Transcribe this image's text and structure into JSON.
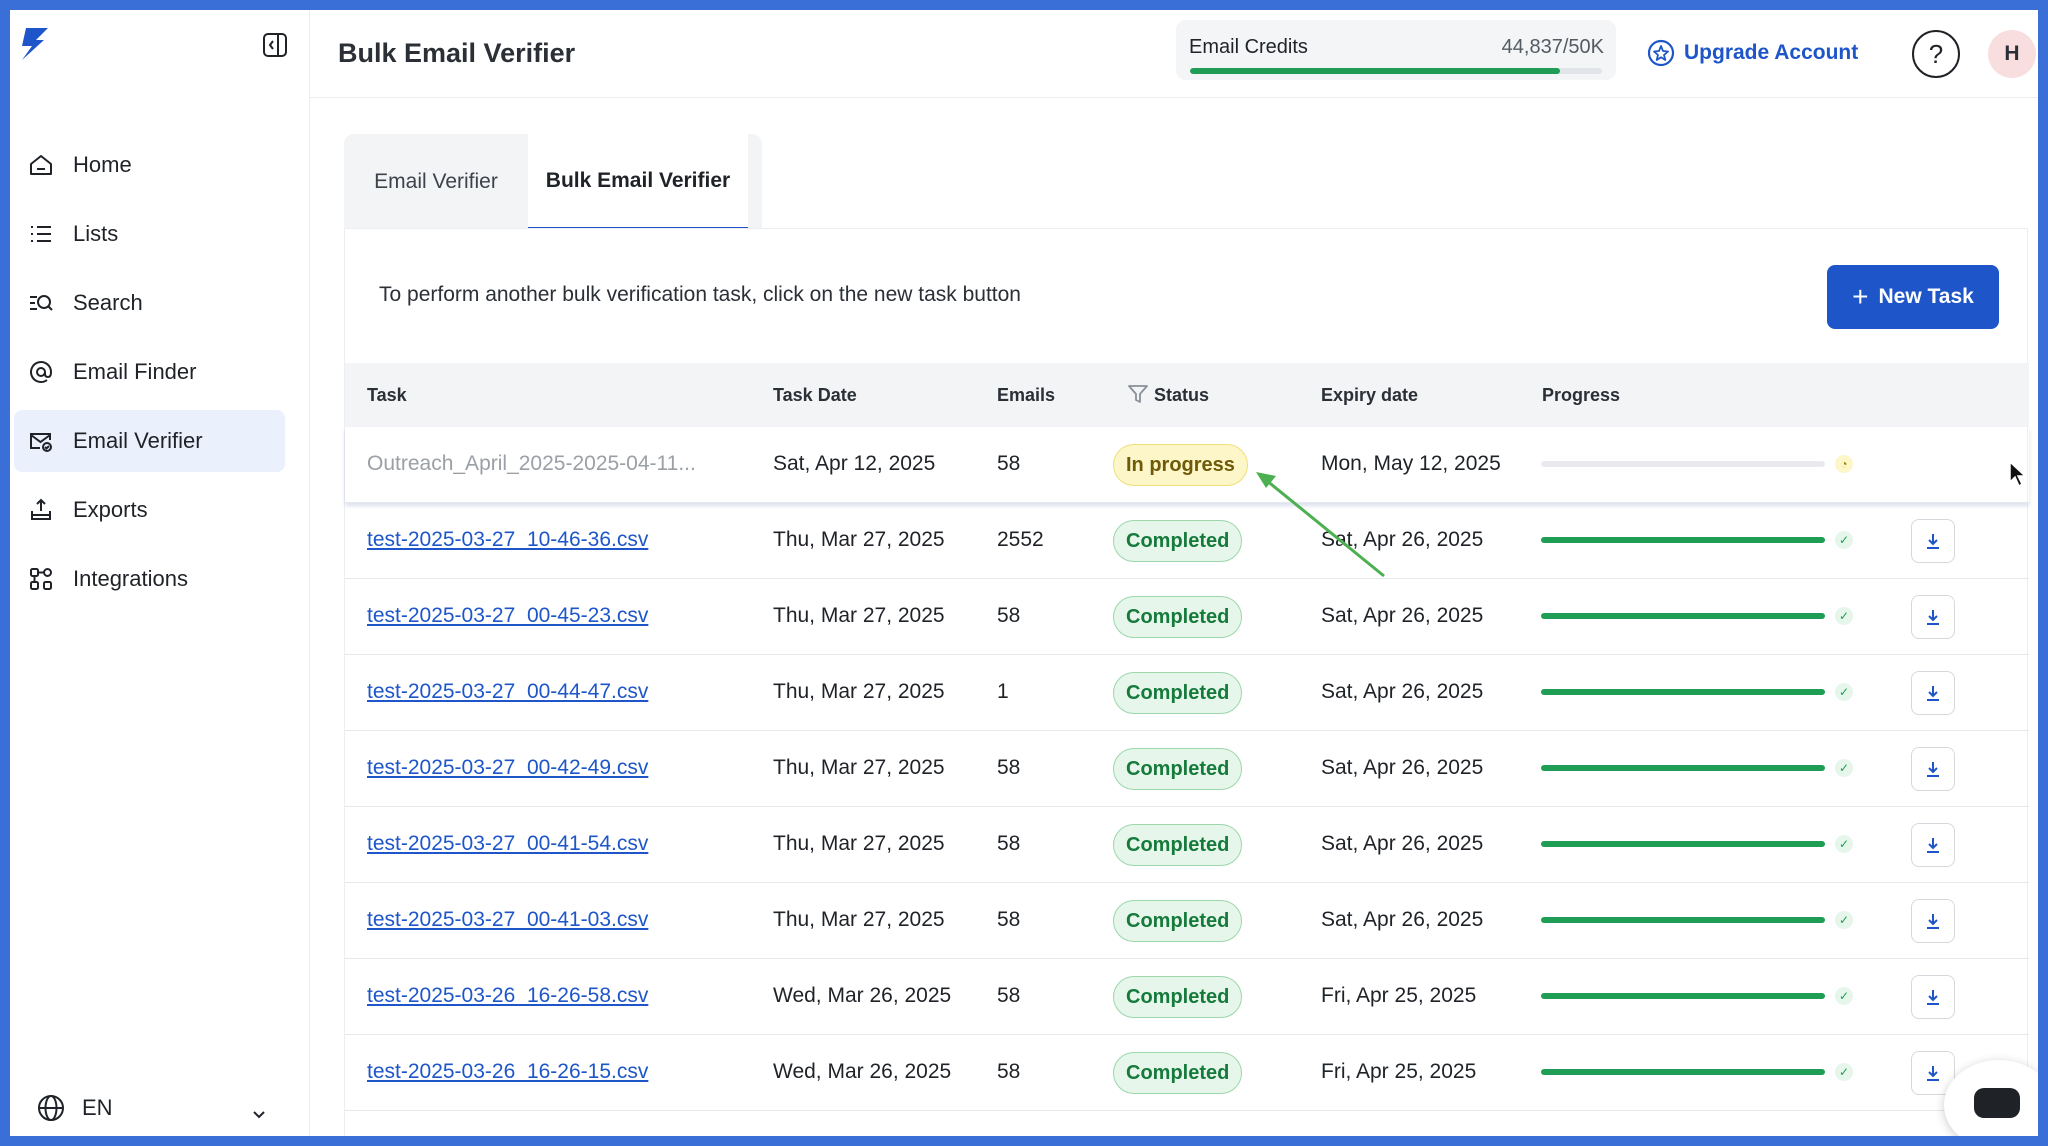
{
  "app": {
    "page_title": "Bulk Email Verifier"
  },
  "header": {
    "credits_label": "Email Credits",
    "credits_value": "44,837/50K",
    "credits_fraction": 0.897,
    "upgrade_label": "Upgrade Account",
    "help_label": "?",
    "avatar_initial": "H"
  },
  "sidebar": {
    "items": [
      {
        "label": "Home",
        "icon": "home-icon"
      },
      {
        "label": "Lists",
        "icon": "list-icon"
      },
      {
        "label": "Search",
        "icon": "search-list-icon"
      },
      {
        "label": "Email Finder",
        "icon": "at-sign-icon"
      },
      {
        "label": "Email Verifier",
        "icon": "mail-check-icon",
        "active": true
      },
      {
        "label": "Exports",
        "icon": "export-icon"
      },
      {
        "label": "Integrations",
        "icon": "integrations-icon"
      }
    ],
    "language": "EN"
  },
  "tabs": [
    {
      "label": "Email Verifier"
    },
    {
      "label": "Bulk Email Verifier",
      "active": true
    }
  ],
  "panel": {
    "hint": "To perform another bulk verification task, click on the new task button",
    "new_task_label": "New Task",
    "new_task_plus": "+"
  },
  "table": {
    "columns": [
      "Task",
      "Task Date",
      "Emails",
      "Status",
      "Expiry date",
      "Progress"
    ],
    "rows": [
      {
        "task": "Outreach_April_2025-2025-04-11...",
        "date": "Sat, Apr 12, 2025",
        "emails": "58",
        "status": "In progress",
        "expiry": "Mon, May 12, 2025",
        "progress": 0.0
      },
      {
        "task": "test-2025-03-27_10-46-36.csv",
        "date": "Thu, Mar 27, 2025",
        "emails": "2552",
        "status": "Completed",
        "expiry": "Sat, Apr 26, 2025",
        "progress": 1.0
      },
      {
        "task": "test-2025-03-27_00-45-23.csv",
        "date": "Thu, Mar 27, 2025",
        "emails": "58",
        "status": "Completed",
        "expiry": "Sat, Apr 26, 2025",
        "progress": 1.0
      },
      {
        "task": "test-2025-03-27_00-44-47.csv",
        "date": "Thu, Mar 27, 2025",
        "emails": "1",
        "status": "Completed",
        "expiry": "Sat, Apr 26, 2025",
        "progress": 1.0
      },
      {
        "task": "test-2025-03-27_00-42-49.csv",
        "date": "Thu, Mar 27, 2025",
        "emails": "58",
        "status": "Completed",
        "expiry": "Sat, Apr 26, 2025",
        "progress": 1.0
      },
      {
        "task": "test-2025-03-27_00-41-54.csv",
        "date": "Thu, Mar 27, 2025",
        "emails": "58",
        "status": "Completed",
        "expiry": "Sat, Apr 26, 2025",
        "progress": 1.0
      },
      {
        "task": "test-2025-03-27_00-41-03.csv",
        "date": "Thu, Mar 27, 2025",
        "emails": "58",
        "status": "Completed",
        "expiry": "Sat, Apr 26, 2025",
        "progress": 1.0
      },
      {
        "task": "test-2025-03-26_16-26-58.csv",
        "date": "Wed, Mar 26, 2025",
        "emails": "58",
        "status": "Completed",
        "expiry": "Fri, Apr 25, 2025",
        "progress": 1.0
      },
      {
        "task": "test-2025-03-26_16-26-15.csv",
        "date": "Wed, Mar 26, 2025",
        "emails": "58",
        "status": "Completed",
        "expiry": "Fri, Apr 25, 2025",
        "progress": 1.0
      }
    ]
  },
  "colors": {
    "accent": "#1e56c9",
    "success": "#1f9d55",
    "warning": "#efdf78",
    "frame": "#3a6fd8"
  }
}
